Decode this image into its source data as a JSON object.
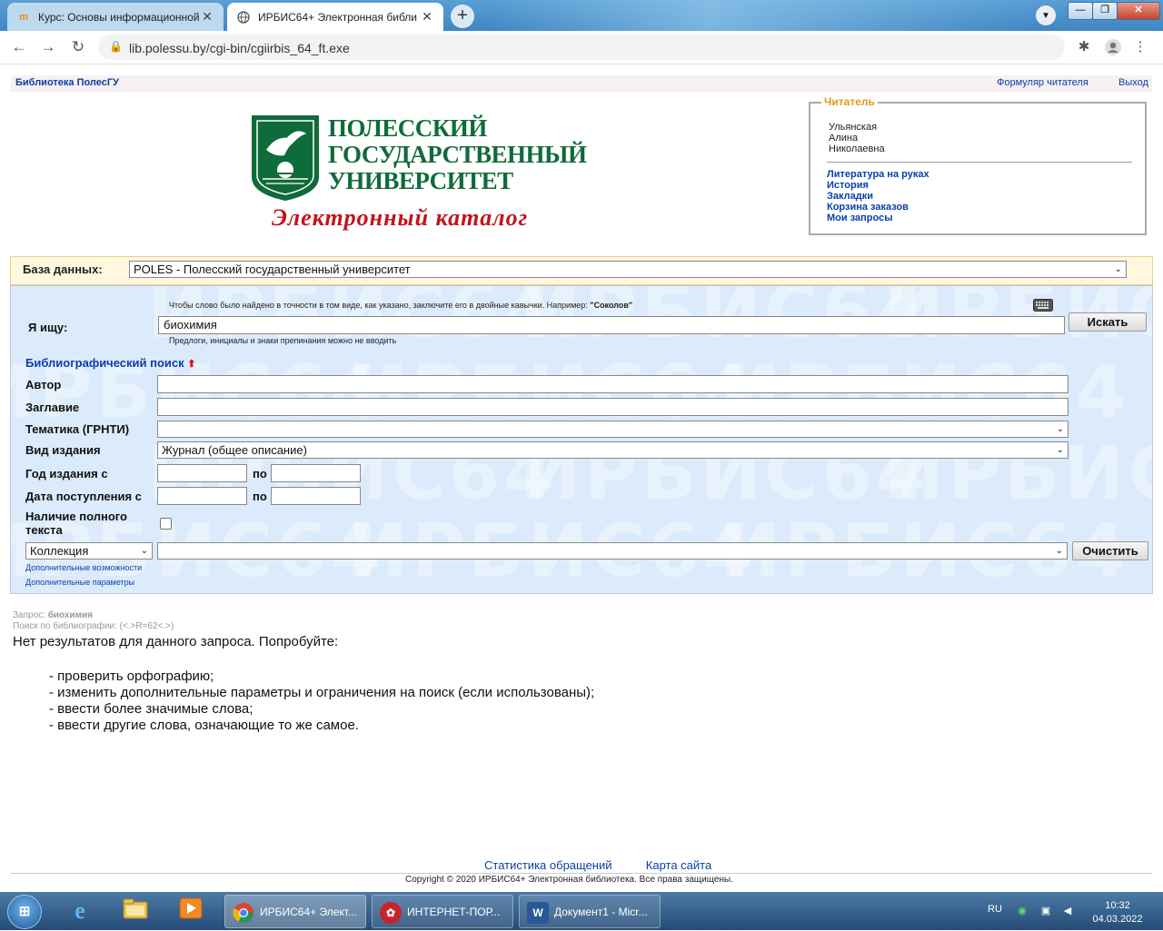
{
  "browser": {
    "tabs": [
      {
        "title": "Курс: Основы информационной",
        "favicon_text": "m",
        "active": false
      },
      {
        "title": "ИРБИС64+ Электронная библи",
        "favicon_text": "",
        "active": true
      }
    ],
    "new_tab": "+",
    "url": "lib.polessu.by/cgi-bin/cgiirbis_64_ft.exe"
  },
  "header": {
    "library_name": "Библиотека ПолесГУ",
    "reader_form_link": "Формуляр читателя",
    "logout_link": "Выход"
  },
  "logo": {
    "university_line1": "ПОЛЕССКИЙ",
    "university_line2": "ГОСУДАРСТВЕННЫЙ",
    "university_line3": "УНИВЕРСИТЕТ",
    "catalog_title": "Электронный каталог"
  },
  "reader": {
    "legend": "Читатель",
    "name_line1": "Ульянская",
    "name_line2": "Алина",
    "name_line3": "Николаевна",
    "links": [
      "Литература на руках",
      "История",
      "Закладки",
      "Корзина заказов",
      "Мои запросы"
    ]
  },
  "database": {
    "label": "База данных:",
    "selected": "POLES - Полесский государственный университет"
  },
  "search": {
    "hint_top": "Чтобы слово было найдено в точности в том виде, как указано, заключите его в двойные кавычки. Например: ",
    "hint_example": "\"Соколов\"",
    "label": "Я ищу:",
    "query": "биохимия",
    "button": "Искать",
    "hint_bottom": "Предлоги, инициалы и знаки препинания можно не вводить",
    "watermark": "ИРБИС64"
  },
  "bib_search": {
    "title": "Библиографический поиск",
    "author_label": "Автор",
    "title_label": "Заглавие",
    "topic_label": "Тематика (ГРНТИ)",
    "topic_value": "",
    "edition_type_label": "Вид издания",
    "edition_type_value": "Журнал (общее описание)",
    "year_label": "Год издания с",
    "to_label": "по",
    "received_label": "Дата поступления с",
    "fulltext_label_line1": "Наличие полного",
    "fulltext_label_line2": "текста",
    "collection_select": "Коллекция",
    "collection_value": "",
    "clear_button": "Очистить",
    "extra_features": "Дополнительные возможности",
    "extra_params": "Дополнительные параметры"
  },
  "results": {
    "query_label": "Запрос: ",
    "query_value": "биохимия",
    "bib_search_line": "Поиск по библиографии: (<.>R=62<.>)",
    "no_results": "Нет результатов для данного запроса. Попробуйте:",
    "tips": [
      "- проверить орфографию;",
      "- изменить дополнительные параметры и ограничения на поиск (если использованы);",
      "- ввести более значимые слова;",
      "- ввести другие слова, означающие то же самое."
    ]
  },
  "footer": {
    "stats_link": "Статистика обращений",
    "sitemap_link": "Карта сайта",
    "copyright": "Copyright © 2020 ИРБИС64+ Электронная библиотека. Все права защищены."
  },
  "taskbar": {
    "tasks": [
      {
        "label": "ИРБИС64+ Элект...",
        "icon": "chrome-icon",
        "active": true
      },
      {
        "label": "ИНТЕРНЕТ-ПОР...",
        "icon": "portal-icon",
        "active": false
      },
      {
        "label": "Документ1 - Micr...",
        "icon": "word-icon",
        "active": false
      }
    ],
    "lang": "RU",
    "time": "10:32",
    "date": "04.03.2022"
  },
  "colors": {
    "link": "#0b3fa8",
    "reader_legend": "#e39a16",
    "university_green": "#0f6b3a",
    "catalog_red": "#c2141c",
    "search_panel": "#dcebfb",
    "db_bar": "#fff8df"
  }
}
